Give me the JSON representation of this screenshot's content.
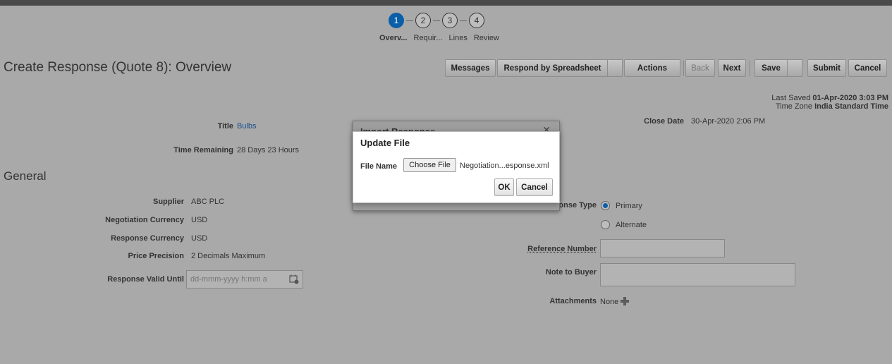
{
  "train": {
    "steps": [
      "1",
      "2",
      "3",
      "4"
    ],
    "labels": [
      "Overv...",
      "Requir...",
      "Lines",
      "Review"
    ]
  },
  "page": {
    "title": "Create Response (Quote 8): Overview"
  },
  "toolbar": {
    "messages": "Messages",
    "respond_by_spreadsheet": "Respond by Spreadsheet",
    "actions": "Actions",
    "back": "Back",
    "next": "Next",
    "save": "Save",
    "submit": "Submit",
    "cancel": "Cancel"
  },
  "status": {
    "last_saved_label": "Last Saved",
    "last_saved_value": "01-Apr-2020 3:03 PM",
    "time_zone_label": "Time Zone",
    "time_zone_value": "India Standard Time"
  },
  "header_fields": {
    "title_label": "Title",
    "title_value": "Bulbs",
    "time_remaining_label": "Time Remaining",
    "time_remaining_value": "28 Days 23 Hours",
    "close_date_label": "Close Date",
    "close_date_value": "30-Apr-2020 2:06 PM"
  },
  "general": {
    "section_title": "General",
    "supplier_label": "Supplier",
    "supplier_value": "ABC PLC",
    "neg_currency_label": "Negotiation Currency",
    "neg_currency_value": "USD",
    "resp_currency_label": "Response Currency",
    "resp_currency_value": "USD",
    "price_precision_label": "Price Precision",
    "price_precision_value": "2 Decimals Maximum",
    "valid_until_label": "Response Valid Until",
    "valid_until_placeholder": "dd-mmm-yyyy h:mm a",
    "response_type_label": "onse Type",
    "response_type_primary": "Primary",
    "response_type_alternate": "Alternate",
    "reference_number_label": "Reference Number",
    "note_to_buyer_label": "Note to Buyer",
    "attachments_label": "Attachments",
    "attachments_value": "None"
  },
  "import_dialog": {
    "title": "Import Response",
    "close": "✕"
  },
  "update_dialog": {
    "title": "Update File",
    "file_name_label": "File Name",
    "choose_file": "Choose File",
    "file_name_value": "Negotiation...esponse.xml",
    "ok": "OK",
    "cancel": "Cancel"
  }
}
